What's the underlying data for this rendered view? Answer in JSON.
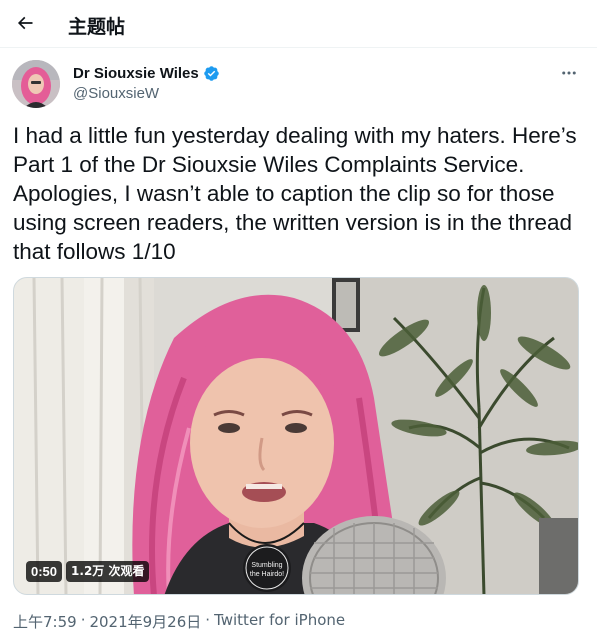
{
  "header": {
    "title": "主题帖",
    "back_icon": "arrow-left-icon"
  },
  "tweet": {
    "author": {
      "display_name": "Dr Siouxsie Wiles",
      "handle": "@SiouxsieW",
      "verified_icon": "verified-badge-icon",
      "verified_color": "#1d9bf0"
    },
    "more_icon": "more-horizontal-icon",
    "text": "I had a little fun yesterday dealing with my haters. Here’s Part 1 of the Dr Siouxsie Wiles Complaints Service. Apologies, I wasn’t able to caption the clip so for those using screen readers, the written version is in the thread that follows 1/10",
    "media": {
      "type": "video",
      "duration": "0:50",
      "views": "1.2万 次观看",
      "necklace_text_line1": "Stumbling",
      "necklace_text_line2": "the Hairdo!"
    },
    "meta": {
      "time": "上午7:59",
      "separator": "·",
      "date": "2021年9月26日",
      "source": "Twitter for iPhone"
    }
  },
  "colors": {
    "text_primary": "#0f1419",
    "text_secondary": "#536471",
    "accent": "#1d9bf0",
    "hair": "#e8669a"
  }
}
